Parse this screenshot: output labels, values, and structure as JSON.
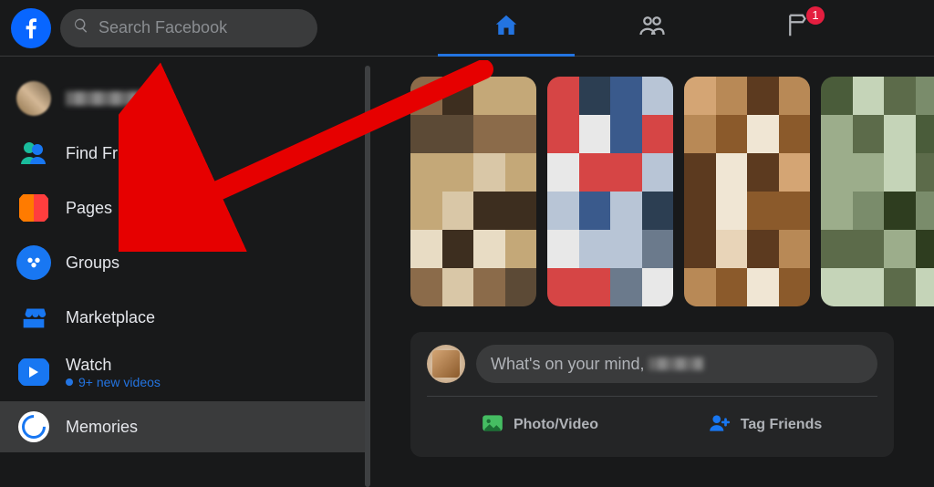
{
  "search": {
    "placeholder": "Search Facebook"
  },
  "top_nav": {
    "home_active": true,
    "watch_badge": "1"
  },
  "sidebar": {
    "items": [
      {
        "label": "Blurred User"
      },
      {
        "label": "Find Friends"
      },
      {
        "label": "Pages"
      },
      {
        "label": "Groups"
      },
      {
        "label": "Marketplace"
      },
      {
        "label": "Watch",
        "sub": "9+ new videos"
      },
      {
        "label": "Memories"
      }
    ]
  },
  "composer": {
    "prompt_prefix": "What's on your mind, ",
    "actions": {
      "photo": "Photo/Video",
      "tag": "Tag Friends"
    }
  },
  "annotation": {
    "arrow_target": "Pages"
  }
}
